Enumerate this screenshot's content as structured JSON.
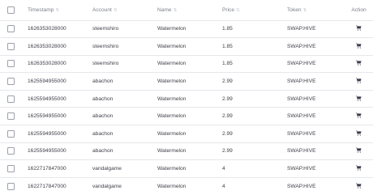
{
  "table": {
    "headers": {
      "timestamp": "Timestamp",
      "account": "Account",
      "name": "Name",
      "price": "Price",
      "token": "Token",
      "action": "Action"
    },
    "sort_icon": "sort-arrows-icon",
    "action_icon": "shopping-cart-icon",
    "rows": [
      {
        "timestamp": "1626353028000",
        "account": "steemshiro",
        "name": "Watermelon",
        "price": "1.85",
        "token": "SWAP.HIVE"
      },
      {
        "timestamp": "1626353028000",
        "account": "steemshiro",
        "name": "Watermelon",
        "price": "1.85",
        "token": "SWAP.HIVE"
      },
      {
        "timestamp": "1626353028000",
        "account": "steemshiro",
        "name": "Watermelon",
        "price": "1.85",
        "token": "SWAP.HIVE"
      },
      {
        "timestamp": "1625594955000",
        "account": "abachon",
        "name": "Watermelon",
        "price": "2.99",
        "token": "SWAP.HIVE"
      },
      {
        "timestamp": "1625594955000",
        "account": "abachon",
        "name": "Watermelon",
        "price": "2.99",
        "token": "SWAP.HIVE"
      },
      {
        "timestamp": "1625594955000",
        "account": "abachon",
        "name": "Watermelon",
        "price": "2.99",
        "token": "SWAP.HIVE"
      },
      {
        "timestamp": "1625594955000",
        "account": "abachon",
        "name": "Watermelon",
        "price": "2.99",
        "token": "SWAP.HIVE"
      },
      {
        "timestamp": "1625594955000",
        "account": "abachon",
        "name": "Watermelon",
        "price": "2.99",
        "token": "SWAP.HIVE"
      },
      {
        "timestamp": "1622717847000",
        "account": "vandalgame",
        "name": "Watermelon",
        "price": "4",
        "token": "SWAP.HIVE"
      },
      {
        "timestamp": "1622717847000",
        "account": "vandalgame",
        "name": "Watermelon",
        "price": "4",
        "token": "SWAP.HIVE"
      }
    ]
  },
  "colors": {
    "text": "#3f3f48",
    "header_text": "#7b7f8a",
    "row_border": "#e5e7eb",
    "icon": "#3a3d4a"
  }
}
